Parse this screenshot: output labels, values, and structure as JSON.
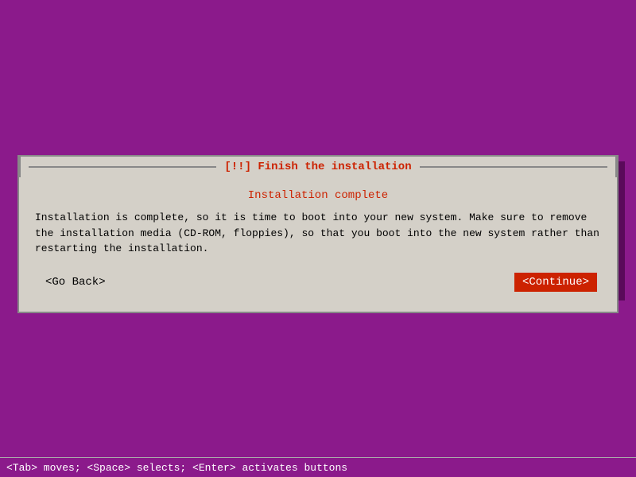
{
  "background_color": "#8B1A8B",
  "dialog": {
    "title": "[!!] Finish the installation",
    "subtitle": "Installation complete",
    "body_text": "Installation is complete, so it is time to boot into your new system. Make sure to remove\nthe installation media (CD-ROM, floppies), so that you boot into the new system rather\nthan restarting the installation.",
    "back_button_label": "<Go Back>",
    "continue_button_label": "<Continue>"
  },
  "status_bar": {
    "text": "<Tab> moves; <Space> selects; <Enter> activates buttons"
  }
}
